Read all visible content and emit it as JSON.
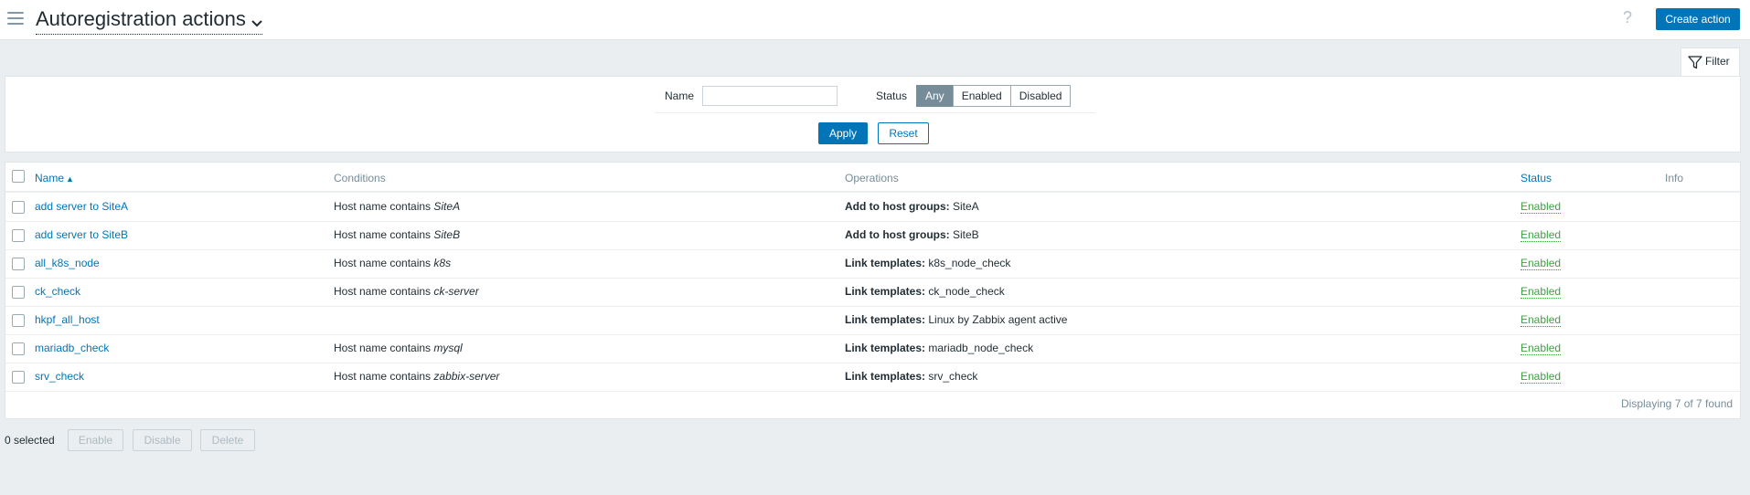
{
  "header": {
    "title": "Autoregistration actions",
    "help": "?",
    "create_button": "Create action"
  },
  "filter": {
    "tab_label": "Filter",
    "name_label": "Name",
    "name_value": "",
    "status_label": "Status",
    "status_options": [
      "Any",
      "Enabled",
      "Disabled"
    ],
    "status_selected": "Any",
    "apply_label": "Apply",
    "reset_label": "Reset"
  },
  "table": {
    "columns": {
      "name": "Name",
      "conditions": "Conditions",
      "operations": "Operations",
      "status": "Status",
      "info": "Info"
    },
    "rows": [
      {
        "name": "add server to SiteA",
        "cond_prefix": "Host name contains ",
        "cond_value": "SiteA",
        "op_label": "Add to host groups:",
        "op_value": " SiteA",
        "status": "Enabled"
      },
      {
        "name": "add server to SiteB",
        "cond_prefix": "Host name contains ",
        "cond_value": "SiteB",
        "op_label": "Add to host groups:",
        "op_value": " SiteB",
        "status": "Enabled"
      },
      {
        "name": "all_k8s_node",
        "cond_prefix": "Host name contains ",
        "cond_value": "k8s",
        "op_label": "Link templates:",
        "op_value": " k8s_node_check",
        "status": "Enabled"
      },
      {
        "name": "ck_check",
        "cond_prefix": "Host name contains ",
        "cond_value": "ck-server",
        "op_label": "Link templates:",
        "op_value": " ck_node_check",
        "status": "Enabled"
      },
      {
        "name": "hkpf_all_host",
        "cond_prefix": "",
        "cond_value": "",
        "op_label": "Link templates:",
        "op_value": " Linux by Zabbix agent active",
        "status": "Enabled"
      },
      {
        "name": "mariadb_check",
        "cond_prefix": "Host name contains ",
        "cond_value": "mysql",
        "op_label": "Link templates:",
        "op_value": " mariadb_node_check",
        "status": "Enabled"
      },
      {
        "name": "srv_check",
        "cond_prefix": "Host name contains ",
        "cond_value": "zabbix-server",
        "op_label": "Link templates:",
        "op_value": " srv_check",
        "status": "Enabled"
      }
    ],
    "footer": "Displaying 7 of 7 found"
  },
  "actions": {
    "selected_count": "0 selected",
    "enable_label": "Enable",
    "disable_label": "Disable",
    "delete_label": "Delete"
  },
  "colors": {
    "primary": "#0275b8",
    "enabled_status": "#429e47",
    "active_segment": "#768d99",
    "background": "#ebeef0"
  }
}
